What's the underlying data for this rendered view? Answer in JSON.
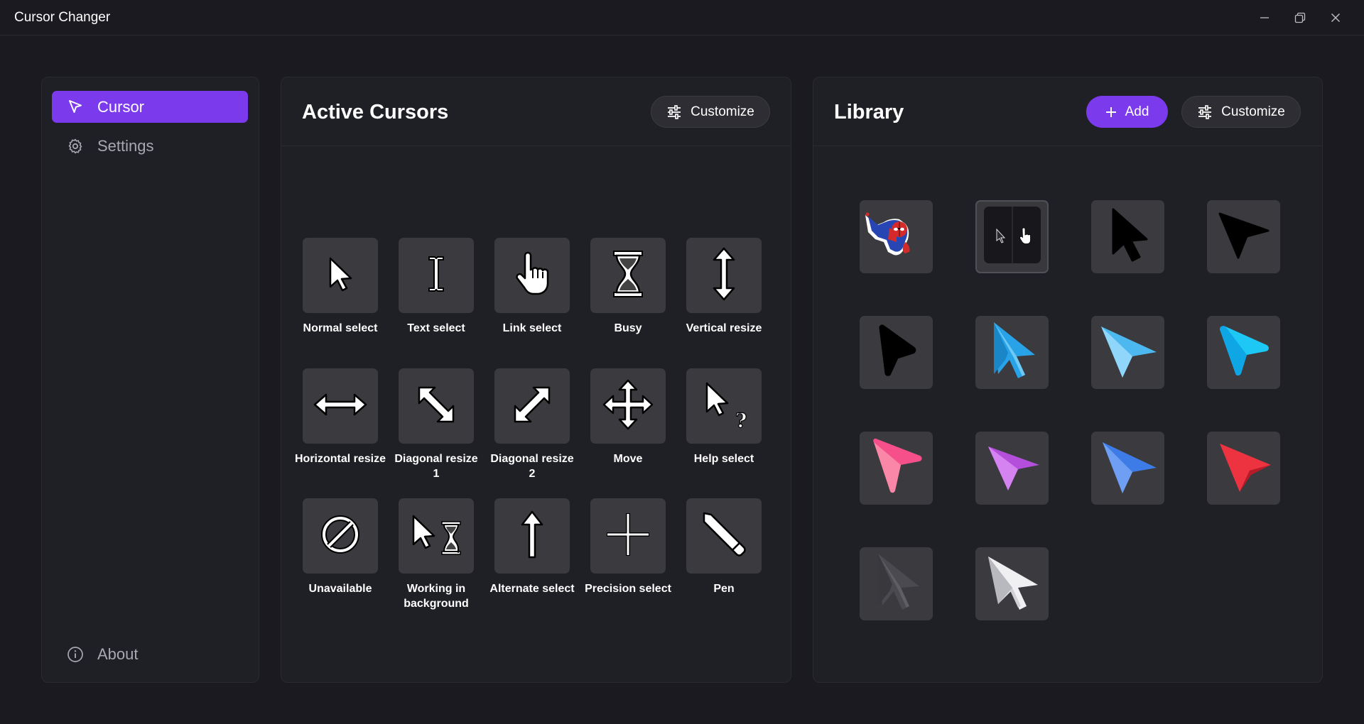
{
  "window": {
    "title": "Cursor Changer",
    "controls": [
      "minimize-icon",
      "restore-icon",
      "close-icon"
    ]
  },
  "sidebar": {
    "items": [
      {
        "label": "Cursor",
        "icon": "cursor-arrow-icon",
        "active": true
      },
      {
        "label": "Settings",
        "icon": "gear-icon",
        "active": false
      }
    ],
    "footer": {
      "label": "About",
      "icon": "info-icon"
    }
  },
  "active_cursors": {
    "title": "Active Cursors",
    "customize_label": "Customize",
    "items": [
      {
        "label": "Normal select",
        "icon": "normal-select-icon"
      },
      {
        "label": "Text select",
        "icon": "text-select-icon"
      },
      {
        "label": "Link select",
        "icon": "link-select-icon"
      },
      {
        "label": "Busy",
        "icon": "busy-icon"
      },
      {
        "label": "Vertical resize",
        "icon": "vertical-resize-icon"
      },
      {
        "label": "Horizontal resize",
        "icon": "horizontal-resize-icon"
      },
      {
        "label": "Diagonal resize 1",
        "icon": "diagonal-resize-1-icon"
      },
      {
        "label": "Diagonal resize 2",
        "icon": "diagonal-resize-2-icon"
      },
      {
        "label": "Move",
        "icon": "move-icon"
      },
      {
        "label": "Help select",
        "icon": "help-select-icon"
      },
      {
        "label": "Unavailable",
        "icon": "unavailable-icon"
      },
      {
        "label": "Working in background",
        "icon": "working-in-background-icon"
      },
      {
        "label": "Alternate select",
        "icon": "alternate-select-icon"
      },
      {
        "label": "Precision select",
        "icon": "precision-select-icon"
      },
      {
        "label": "Pen",
        "icon": "pen-icon"
      }
    ]
  },
  "library": {
    "title": "Library",
    "add_label": "Add",
    "customize_label": "Customize",
    "items": [
      {
        "icon": "spiderman-cursor-icon"
      },
      {
        "icon": "small-cursor-pack-icon",
        "selected": true
      },
      {
        "icon": "black-arrow-cursor-icon",
        "color": "#000000"
      },
      {
        "icon": "black-pointer-cursor-icon",
        "color": "#000000"
      },
      {
        "icon": "black-rounded-pointer-icon",
        "color": "#000000"
      },
      {
        "icon": "light-blue-arrow-cursor-icon",
        "color": "#29a3e8"
      },
      {
        "icon": "sky-blue-pointer-icon",
        "color": "#4db8f0"
      },
      {
        "icon": "cyan-pointer-icon",
        "color": "#1ec8f5"
      },
      {
        "icon": "pink-pointer-icon",
        "color": "#f5508a"
      },
      {
        "icon": "purple-pointer-icon",
        "color": "#b34fdb"
      },
      {
        "icon": "blue-pointer-icon",
        "color": "#3d7be6"
      },
      {
        "icon": "red-pointer-icon",
        "color": "#ee3340"
      },
      {
        "icon": "dark-gray-arrow-cursor-icon",
        "color": "#4a4a50"
      },
      {
        "icon": "white-arrow-cursor-icon",
        "color": "#f0f0f2"
      }
    ]
  },
  "colors": {
    "accent": "#7c3aed",
    "background": "#1a1a20",
    "panel": "#1f1f26",
    "tile": "#3a3a3f"
  }
}
